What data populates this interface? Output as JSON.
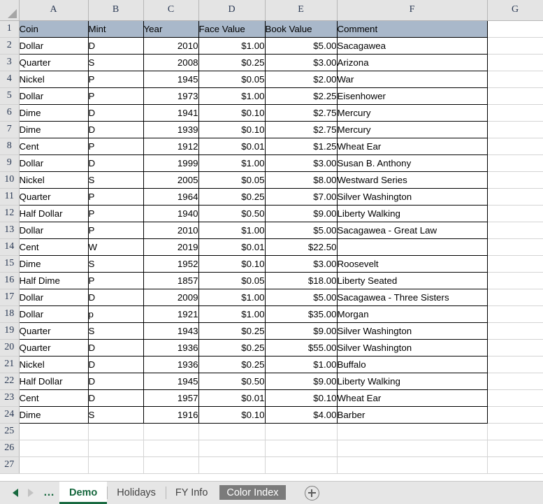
{
  "spreadsheet": {
    "column_headers": [
      "A",
      "B",
      "C",
      "D",
      "E",
      "F",
      "G"
    ],
    "row_numbers": [
      "1",
      "2",
      "3",
      "4",
      "5",
      "6",
      "7",
      "8",
      "9",
      "10",
      "11",
      "12",
      "13",
      "14",
      "15",
      "16",
      "17",
      "18",
      "19",
      "20",
      "21",
      "22",
      "23",
      "24",
      "25",
      "26",
      "27"
    ],
    "table_header": {
      "fill_color": "#a9b8ca",
      "cells": [
        "Coin",
        "Mint",
        "Year",
        "Face Value",
        "Book Value",
        "Comment"
      ]
    },
    "columns": [
      "Coin",
      "Mint",
      "Year",
      "Face Value",
      "Book Value",
      "Comment"
    ],
    "rows": [
      {
        "coin": "Dollar",
        "mint": "D",
        "year": "2010",
        "face_value": "$1.00",
        "book_value": "$5.00",
        "comment": "Sacagawea"
      },
      {
        "coin": "Quarter",
        "mint": "S",
        "year": "2008",
        "face_value": "$0.25",
        "book_value": "$3.00",
        "comment": "Arizona"
      },
      {
        "coin": "Nickel",
        "mint": "P",
        "year": "1945",
        "face_value": "$0.05",
        "book_value": "$2.00",
        "comment": "War"
      },
      {
        "coin": "Dollar",
        "mint": "P",
        "year": "1973",
        "face_value": "$1.00",
        "book_value": "$2.25",
        "comment": "Eisenhower"
      },
      {
        "coin": "Dime",
        "mint": "D",
        "year": "1941",
        "face_value": "$0.10",
        "book_value": "$2.75",
        "comment": "Mercury"
      },
      {
        "coin": "Dime",
        "mint": "D",
        "year": "1939",
        "face_value": "$0.10",
        "book_value": "$2.75",
        "comment": "Mercury"
      },
      {
        "coin": "Cent",
        "mint": "P",
        "year": "1912",
        "face_value": "$0.01",
        "book_value": "$1.25",
        "comment": "Wheat Ear"
      },
      {
        "coin": "Dollar",
        "mint": "D",
        "year": "1999",
        "face_value": "$1.00",
        "book_value": "$3.00",
        "comment": "Susan B. Anthony"
      },
      {
        "coin": "Nickel",
        "mint": "S",
        "year": "2005",
        "face_value": "$0.05",
        "book_value": "$8.00",
        "comment": "Westward Series"
      },
      {
        "coin": "Quarter",
        "mint": "P",
        "year": "1964",
        "face_value": "$0.25",
        "book_value": "$7.00",
        "comment": "Silver Washington"
      },
      {
        "coin": "Half Dollar",
        "mint": "P",
        "year": "1940",
        "face_value": "$0.50",
        "book_value": "$9.00",
        "comment": "Liberty Walking"
      },
      {
        "coin": "Dollar",
        "mint": "P",
        "year": "2010",
        "face_value": "$1.00",
        "book_value": "$5.00",
        "comment": "Sacagawea - Great Law"
      },
      {
        "coin": "Cent",
        "mint": "W",
        "year": "2019",
        "face_value": "$0.01",
        "book_value": "$22.50",
        "comment": ""
      },
      {
        "coin": "Dime",
        "mint": "S",
        "year": "1952",
        "face_value": "$0.10",
        "book_value": "$3.00",
        "comment": "Roosevelt"
      },
      {
        "coin": "Half Dime",
        "mint": "P",
        "year": "1857",
        "face_value": "$0.05",
        "book_value": "$18.00",
        "comment": "Liberty Seated"
      },
      {
        "coin": "Dollar",
        "mint": "D",
        "year": "2009",
        "face_value": "$1.00",
        "book_value": "$5.00",
        "comment": "Sacagawea - Three Sisters"
      },
      {
        "coin": "Dollar",
        "mint": "p",
        "year": "1921",
        "face_value": "$1.00",
        "book_value": "$35.00",
        "comment": "Morgan"
      },
      {
        "coin": "Quarter",
        "mint": "S",
        "year": "1943",
        "face_value": "$0.25",
        "book_value": "$9.00",
        "comment": "Silver Washington"
      },
      {
        "coin": "Quarter",
        "mint": "D",
        "year": "1936",
        "face_value": "$0.25",
        "book_value": "$55.00",
        "comment": "Silver Washington"
      },
      {
        "coin": "Nickel",
        "mint": "D",
        "year": "1936",
        "face_value": "$0.25",
        "book_value": "$1.00",
        "comment": "Buffalo"
      },
      {
        "coin": "Half Dollar",
        "mint": "D",
        "year": "1945",
        "face_value": "$0.50",
        "book_value": "$9.00",
        "comment": "Liberty Walking"
      },
      {
        "coin": "Cent",
        "mint": "D",
        "year": "1957",
        "face_value": "$0.01",
        "book_value": "$0.10",
        "comment": "Wheat Ear"
      },
      {
        "coin": "Dime",
        "mint": "S",
        "year": "1916",
        "face_value": "$0.10",
        "book_value": "$4.00",
        "comment": "Barber"
      }
    ],
    "empty_rows_count": 3
  },
  "sheet_tabs": {
    "nav": {
      "prev_label": "◀",
      "next_label": "▶",
      "ellipsis_label": "…"
    },
    "tabs": [
      {
        "label": "Demo",
        "state": "active"
      },
      {
        "label": "Holidays",
        "state": "normal"
      },
      {
        "label": "FY Info",
        "state": "normal"
      },
      {
        "label": "Color Index",
        "state": "selected-dark"
      }
    ],
    "add_sheet_label": "+",
    "active_tab_color": "#17693f",
    "selected_tab_bg": "#7b7b7b"
  }
}
